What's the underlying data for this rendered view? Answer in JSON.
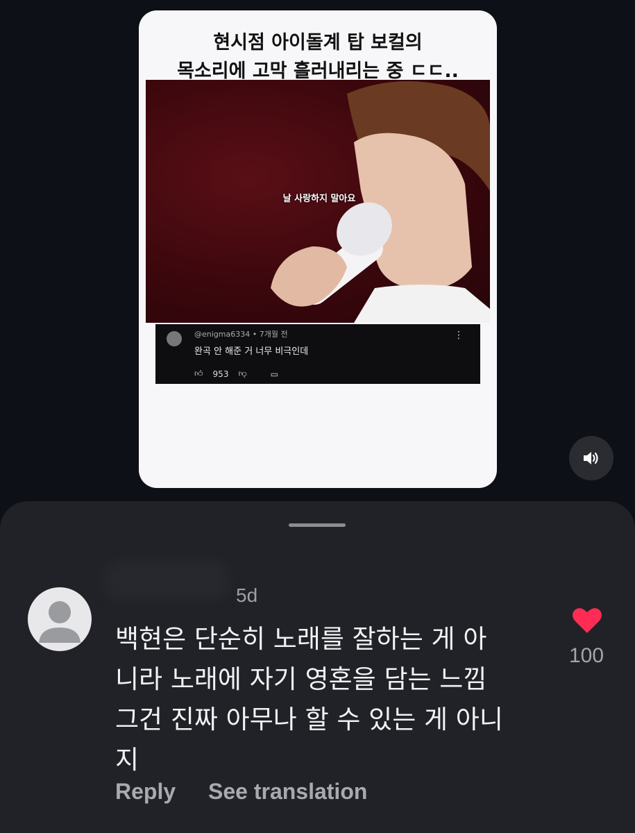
{
  "post": {
    "title_lines": [
      "현시점 아이돌계 탑 보컬의",
      "목소리에 고막 흘러내리는 중 ㄷㄷ.."
    ],
    "video_subtitle": "날 사랑하지 말아요",
    "embedded_comment": {
      "username": "@enigma6334",
      "time": "7개월 전",
      "text": "완곡 안 해준 거 너무 비극인데",
      "likes": "953"
    }
  },
  "sound_icon": "speaker-icon",
  "sheet": {
    "comment": {
      "timestamp": "5d",
      "text_lines": [
        "백현은 단순히 노래를 잘하는 게 아",
        "니라 노래에 자기 영혼을 담는 느낌",
        "그건 진짜 아무나 할 수 있는 게 아니",
        "지"
      ],
      "like_count": "100",
      "reply_label": "Reply",
      "translate_label": "See translation"
    }
  },
  "colors": {
    "background": "#0d1016",
    "sheet": "#202227",
    "heart": "#fe2c55"
  }
}
